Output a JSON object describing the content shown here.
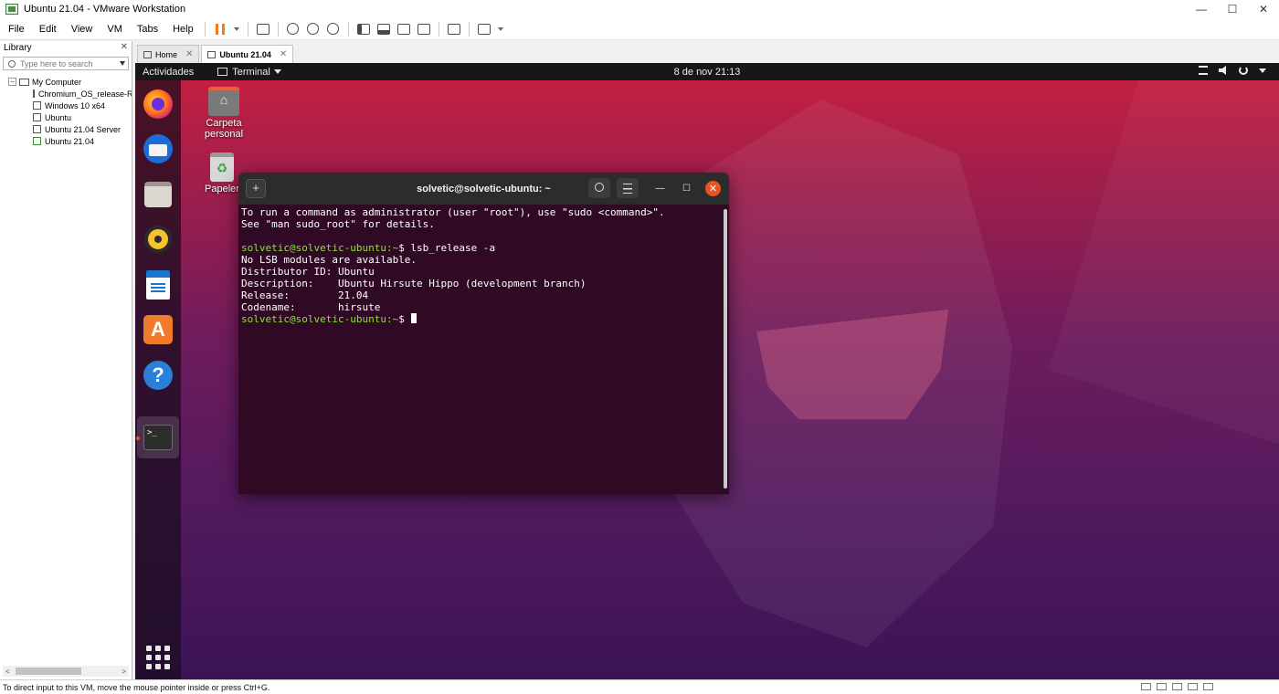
{
  "window": {
    "title": "Ubuntu 21.04 - VMware Workstation",
    "controls": [
      "—",
      "☐",
      "✕"
    ]
  },
  "menubar": {
    "items": [
      "File",
      "Edit",
      "View",
      "VM",
      "Tabs",
      "Help"
    ]
  },
  "library": {
    "title": "Library",
    "close": "✕",
    "search_placeholder": "Type here to search",
    "root": "My Computer",
    "vms": [
      "Chromium_OS_release-R",
      "Windows 10 x64",
      "Ubuntu",
      "Ubuntu 21.04 Server",
      "Ubuntu 21.04"
    ],
    "active_vm": "Ubuntu 21.04",
    "scroll_left": "<",
    "scroll_right": ">"
  },
  "tabs": [
    {
      "label": "Home",
      "active": false
    },
    {
      "label": "Ubuntu 21.04",
      "active": true
    }
  ],
  "tab_close": "✕",
  "ubuntu": {
    "activities": "Actividades",
    "app_menu": "Terminal",
    "clock": "8 de nov  21:13",
    "tray": [
      "network-icon",
      "volume-icon",
      "power-icon",
      "menu-caret-icon"
    ],
    "dock": [
      "firefox-icon",
      "thunderbird-icon",
      "files-icon",
      "rhythmbox-icon",
      "libreoffice-writer-icon",
      "software-store-icon",
      "help-icon",
      "terminal-icon",
      "show-apps-icon"
    ],
    "desktop_icons": [
      {
        "label": "Carpeta personal",
        "icon": "home-folder-icon"
      },
      {
        "label": "Papeler",
        "icon": "trash-icon"
      }
    ],
    "accent": "#e95420"
  },
  "terminal": {
    "title": "solvetic@solvetic-ubuntu: ~",
    "lines": [
      {
        "prompt": "",
        "text": "To run a command as administrator (user \"root\"), use \"sudo <command>\"."
      },
      {
        "prompt": "",
        "text": "See \"man sudo_root\" for details."
      },
      {
        "prompt": "",
        "text": ""
      },
      {
        "prompt": "solvetic@solvetic-ubuntu:~",
        "text": "$ lsb_release -a"
      },
      {
        "prompt": "",
        "text": "No LSB modules are available."
      },
      {
        "prompt": "",
        "text": "Distributor ID:\tUbuntu"
      },
      {
        "prompt": "",
        "text": "Description:\tUbuntu Hirsute Hippo (development branch)"
      },
      {
        "prompt": "",
        "text": "Release:\t21.04"
      },
      {
        "prompt": "",
        "text": "Codename:\thirsute"
      },
      {
        "prompt": "solvetic@solvetic-ubuntu:~",
        "text": "$ "
      }
    ],
    "prompt_color": "#8ae234",
    "background": "#300a24"
  },
  "statusbar": {
    "text": "To direct input to this VM, move the mouse pointer inside or press Ctrl+G."
  }
}
